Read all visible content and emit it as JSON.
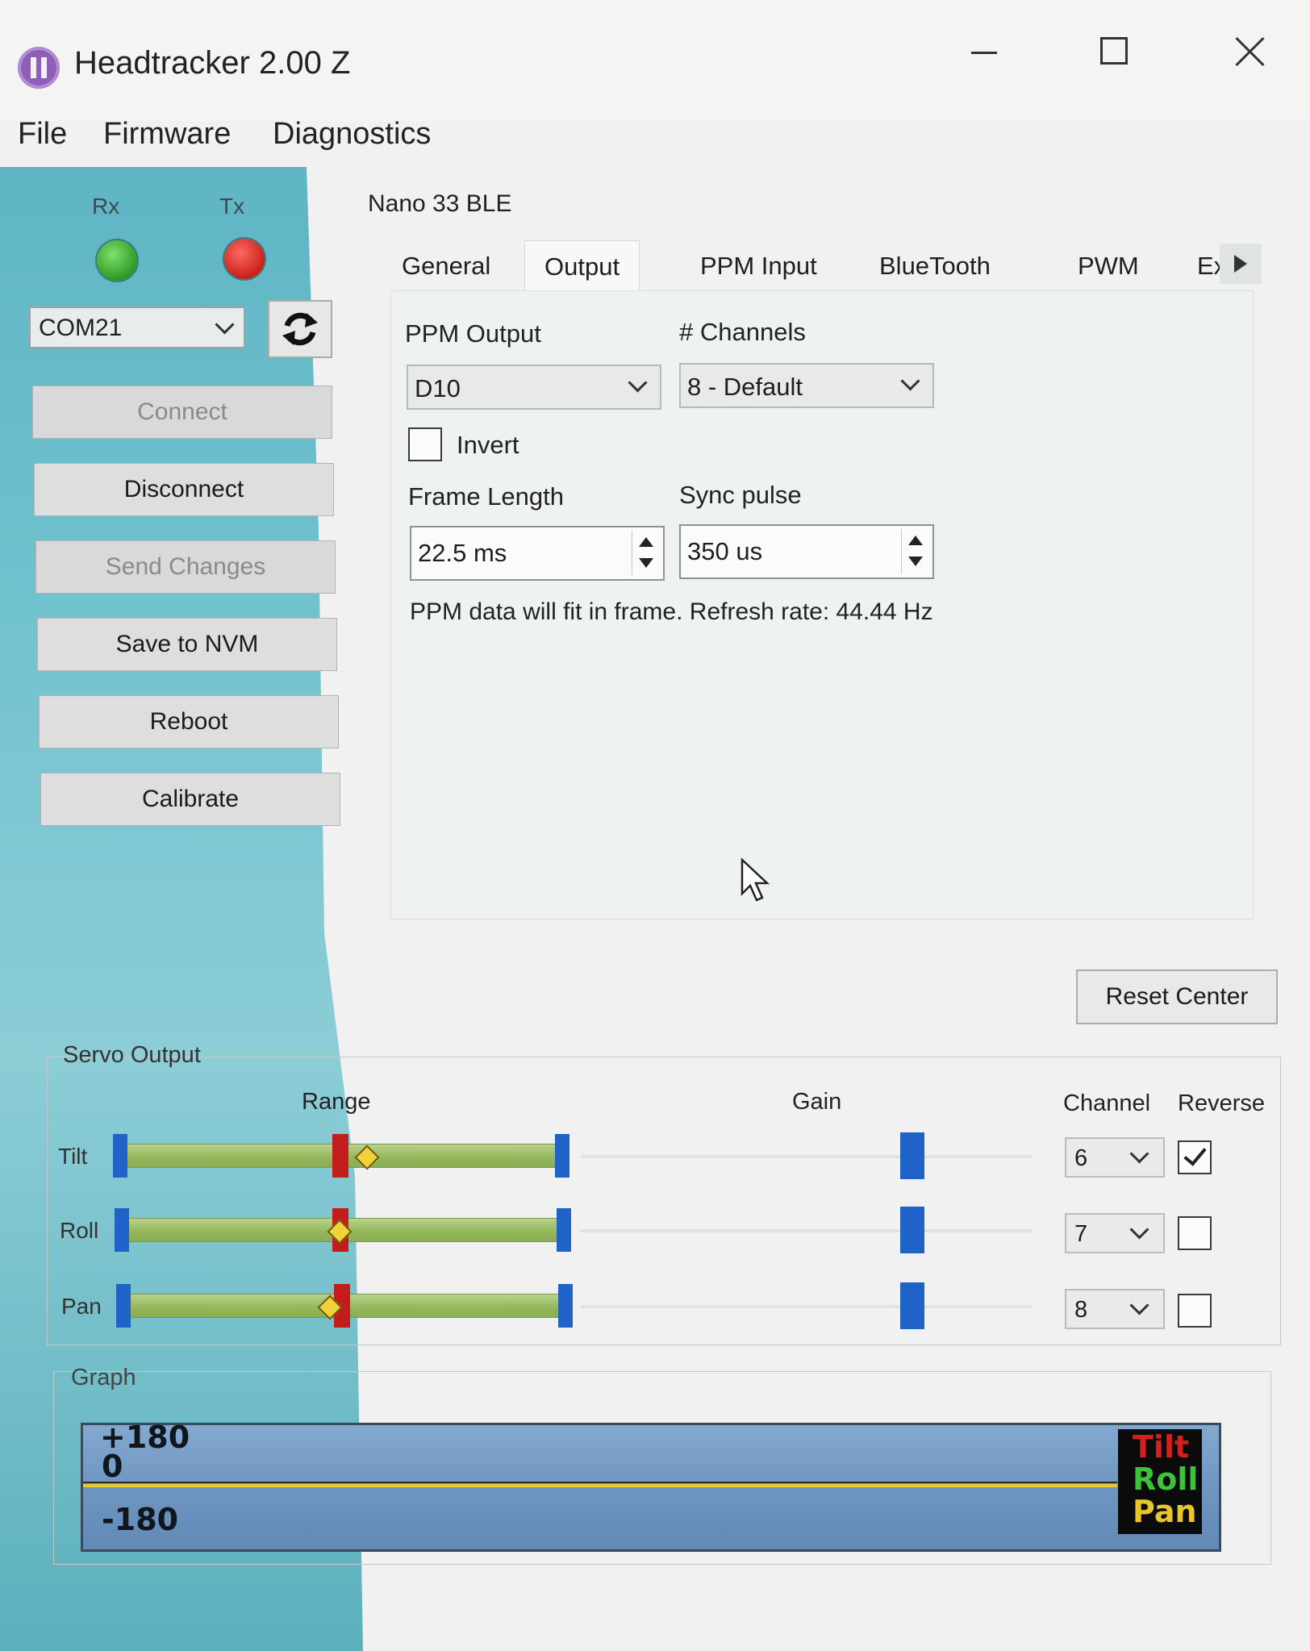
{
  "window": {
    "title": "Headtracker 2.00 Z"
  },
  "menu": [
    "File",
    "Firmware",
    "Diagnostics"
  ],
  "status_leds": {
    "rx": {
      "label": "Rx",
      "color": "#3aa62e"
    },
    "tx": {
      "label": "Tx",
      "color": "#d62b22"
    }
  },
  "connection": {
    "port": "COM21",
    "buttons": {
      "connect": "Connect",
      "disconnect": "Disconnect",
      "send_changes": "Send Changes",
      "save_nvm": "Save to NVM",
      "reboot": "Reboot",
      "calibrate": "Calibrate"
    }
  },
  "device": "Nano 33 BLE",
  "tabs": [
    "General",
    "Output",
    "PPM Input",
    "BlueTooth",
    "PWM",
    "Extras"
  ],
  "active_tab": "Output",
  "output": {
    "ppm_output_label": "PPM Output",
    "ppm_output_value": "D10",
    "channels_label": "# Channels",
    "channels_value": "8 - Default",
    "invert_label": "Invert",
    "invert_checked": false,
    "frame_length_label": "Frame Length",
    "frame_length_value": "22.5 ms",
    "sync_pulse_label": "Sync pulse",
    "sync_pulse_value": "350 us",
    "status": "PPM data will fit in frame. Refresh rate: 44.44 Hz"
  },
  "reset_center": "Reset Center",
  "servo_output": {
    "title": "Servo Output",
    "range_header": "Range",
    "gain_header": "Gain",
    "channel_header": "Channel",
    "reverse_header": "Reverse",
    "axes": [
      {
        "name": "Tilt",
        "channel": "6",
        "reverse": true,
        "center_pct": 50,
        "value_pct": 57
      },
      {
        "name": "Roll",
        "channel": "7",
        "reverse": false,
        "center_pct": 50,
        "value_pct": 49
      },
      {
        "name": "Pan",
        "channel": "8",
        "reverse": false,
        "center_pct": 50,
        "value_pct": 46
      }
    ]
  },
  "graph": {
    "title": "Graph",
    "max_label": "+180",
    "zero_label": "0",
    "min_label": "-180",
    "legend": [
      {
        "name": "Tilt",
        "color": "#d3201c"
      },
      {
        "name": "Roll",
        "color": "#3cc33a"
      },
      {
        "name": "Pan",
        "color": "#e8c52c"
      }
    ]
  }
}
